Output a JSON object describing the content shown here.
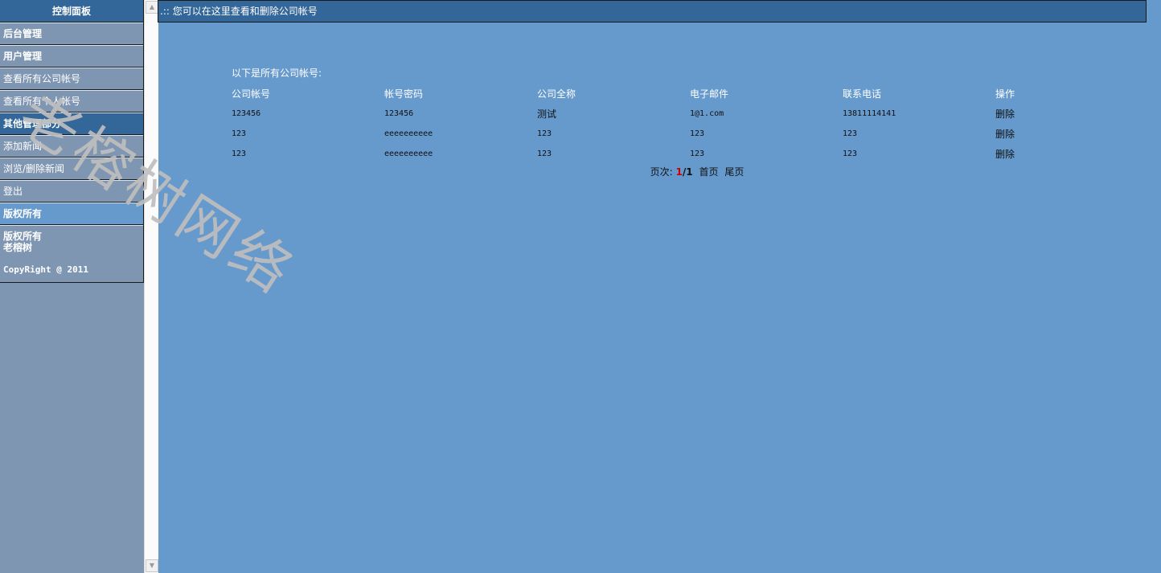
{
  "sidebar": {
    "title": "控制面板",
    "sections": [
      {
        "label": "后台管理",
        "type": "section"
      },
      {
        "label": "用户管理",
        "type": "section"
      },
      {
        "label": "查看所有公司帐号",
        "type": "link"
      },
      {
        "label": "查看所有个人帐号",
        "type": "link"
      },
      {
        "label": "其他管理部分",
        "type": "section"
      },
      {
        "label": "添加新闻",
        "type": "link"
      },
      {
        "label": "浏览/删除新闻",
        "type": "link"
      },
      {
        "label": "登出",
        "type": "link"
      },
      {
        "label": "版权所有",
        "type": "section"
      }
    ],
    "footer": {
      "line1": "版权所有",
      "line2": "老榕树",
      "copyright": "CopyRight @ 2011"
    }
  },
  "header": {
    "text": ".:: 您可以在这里查看和删除公司帐号"
  },
  "content": {
    "intro": "以下是所有公司帐号:",
    "columns": [
      "公司帐号",
      "帐号密码",
      "公司全称",
      "电子邮件",
      "联系电话",
      "操作"
    ],
    "rows": [
      [
        "123456",
        "123456",
        "测试",
        "1@1.com",
        "13811114141",
        "删除"
      ],
      [
        "123",
        "eeeeeeeeee",
        "123",
        "123",
        "123",
        "删除"
      ],
      [
        "123",
        "eeeeeeeeee",
        "123",
        "123",
        "123",
        "删除"
      ]
    ]
  },
  "pager": {
    "label": "页次:",
    "current": "1",
    "total": "/1",
    "first": "首页",
    "last": "尾页"
  },
  "watermark": "老榕树网络",
  "colors": {
    "background": "#6699cc",
    "header": "#336699",
    "sidebar": "#7f96b2",
    "pager_current": "#cc0000"
  }
}
